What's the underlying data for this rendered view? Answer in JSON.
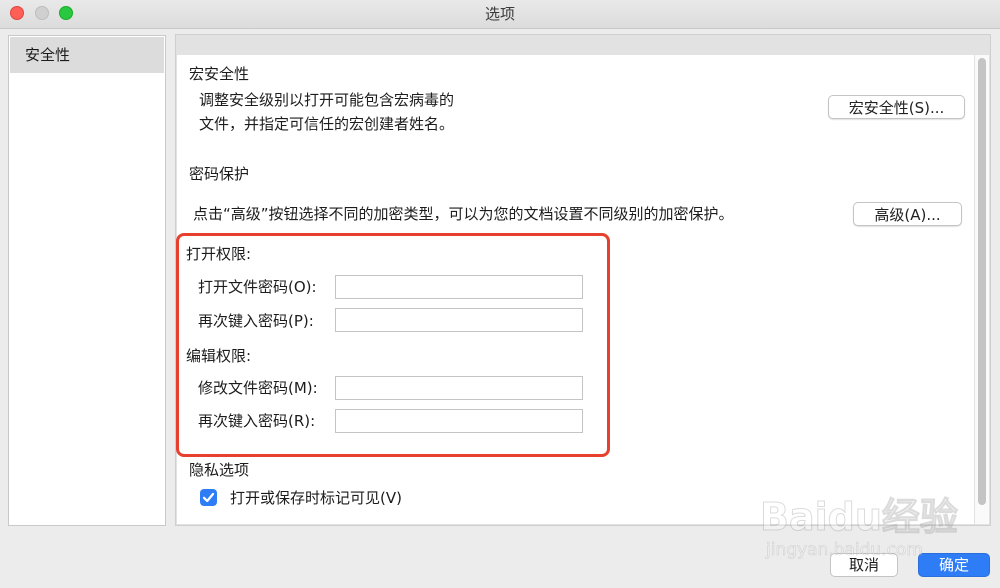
{
  "window": {
    "title": "选项"
  },
  "sidebar": {
    "items": [
      {
        "label": "安全性"
      }
    ]
  },
  "macro_security": {
    "heading": "宏安全性",
    "description_line1": "调整安全级别以打开可能包含宏病毒的",
    "description_line2": "文件，并指定可信任的宏创建者姓名。",
    "button_label": "宏安全性(S)..."
  },
  "password_protection": {
    "heading": "密码保护",
    "description": "点击“高级”按钮选择不同的加密类型，可以为您的文档设置不同级别的加密保护。",
    "advanced_button_label": "高级(A)...",
    "open_permission": {
      "heading": "打开权限:",
      "open_password_label": "打开文件密码(O):",
      "open_password_value": "",
      "reenter_label": "再次键入密码(P):",
      "reenter_value": ""
    },
    "edit_permission": {
      "heading": "编辑权限:",
      "modify_password_label": "修改文件密码(M):",
      "modify_password_value": "",
      "reenter_label": "再次键入密码(R):",
      "reenter_value": ""
    }
  },
  "privacy": {
    "heading": "隐私选项",
    "checkbox_label": "打开或保存时标记可见(V)",
    "checkbox_checked": true
  },
  "footer": {
    "cancel_label": "取消",
    "ok_label": "确定"
  },
  "watermark": {
    "brand": "Baidu经验",
    "url": "jingyan.baidu.com"
  },
  "colors": {
    "accent": "#2f7df6",
    "highlight_border": "#e8402f",
    "close": "#fe5f57",
    "zoom": "#28c840"
  }
}
